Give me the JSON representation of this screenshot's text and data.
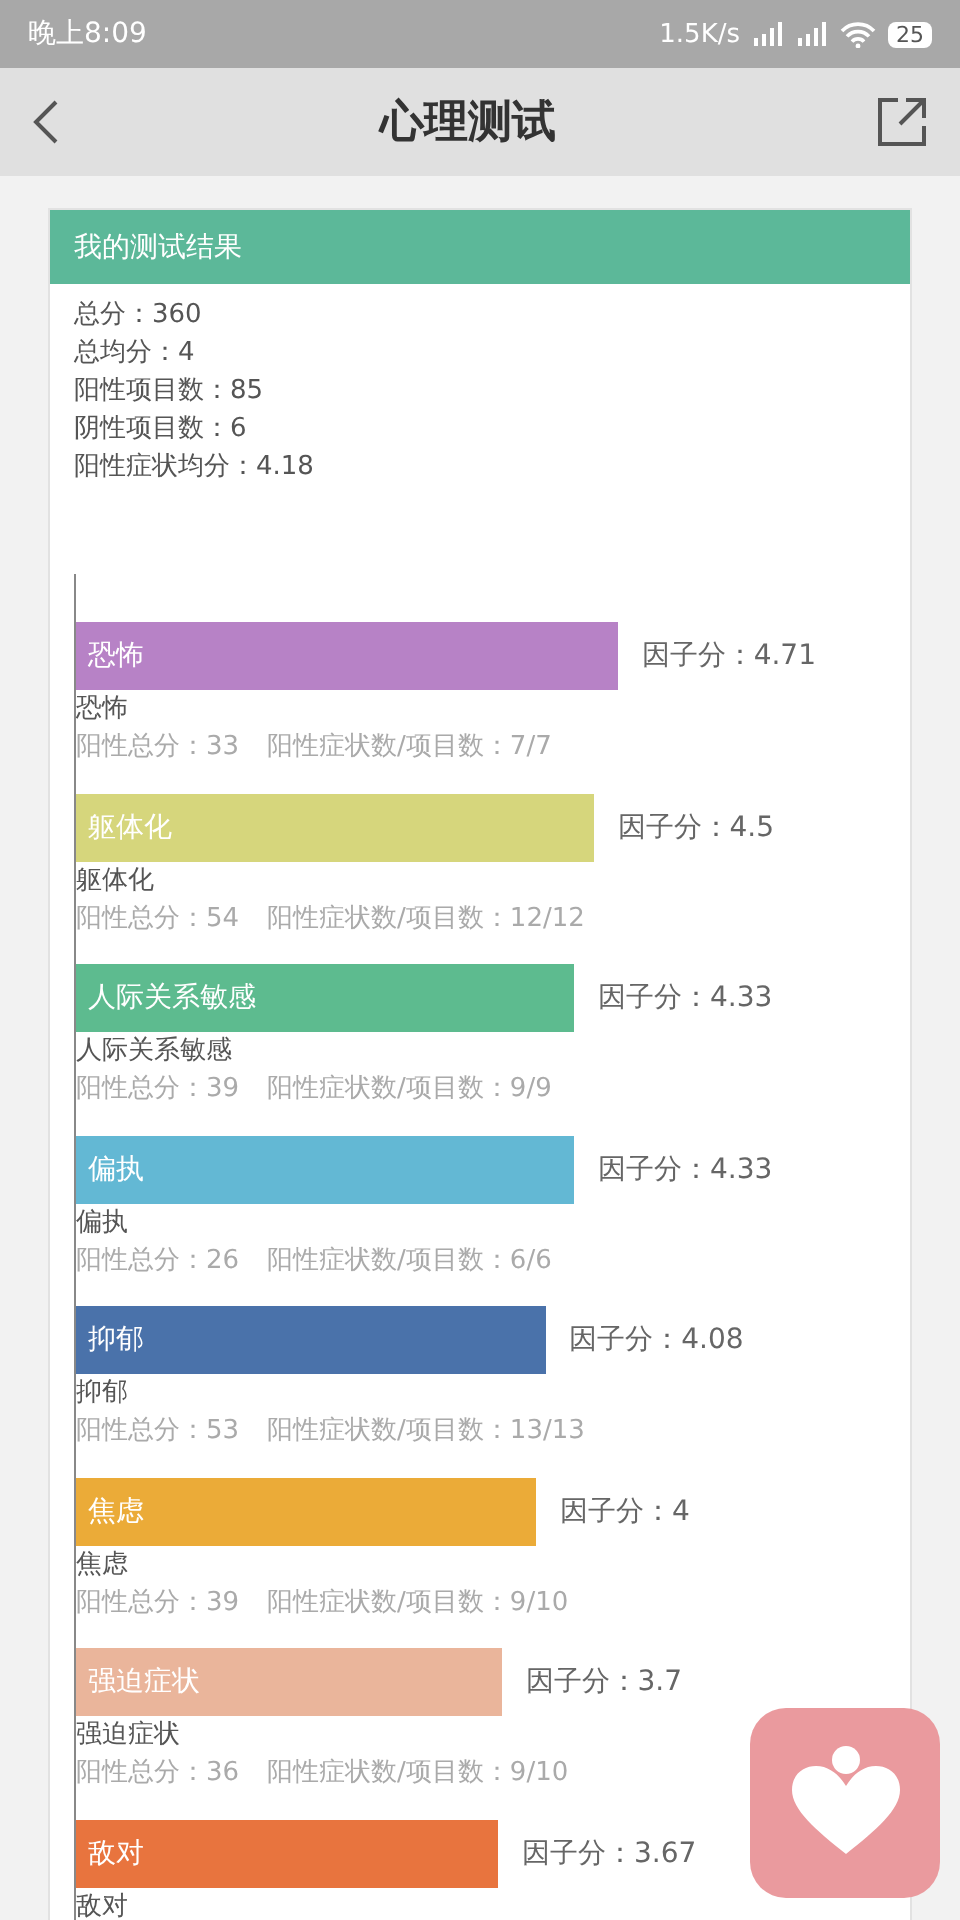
{
  "status_bar": {
    "time": "晚上8:09",
    "speed": "1.5K/s",
    "battery": "25"
  },
  "nav": {
    "title": "心理测试"
  },
  "card": {
    "title": "我的测试结果",
    "summary": [
      "总分：360",
      "总均分：4",
      "阳性项目数：85",
      "阴性项目数：6",
      "阳性症状均分：4.18"
    ],
    "factors": [
      {
        "bar_label": "恐怖",
        "color": "#b782c6",
        "score": "因子分：4.71",
        "name": "恐怖",
        "stat_total": "阳性总分：33",
        "stat_ratio": "阳性症状数/项目数：7/7"
      },
      {
        "bar_label": "躯体化",
        "color": "#d6d67c",
        "score": "因子分：4.5",
        "name": "躯体化",
        "stat_total": "阳性总分：54",
        "stat_ratio": "阳性症状数/项目数：12/12"
      },
      {
        "bar_label": "人际关系敏感",
        "color": "#5dbb8f",
        "score": "因子分：4.33",
        "name": "人际关系敏感",
        "stat_total": "阳性总分：39",
        "stat_ratio": "阳性症状数/项目数：9/9"
      },
      {
        "bar_label": "偏执",
        "color": "#63b8d4",
        "score": "因子分：4.33",
        "name": "偏执",
        "stat_total": "阳性总分：26",
        "stat_ratio": "阳性症状数/项目数：6/6"
      },
      {
        "bar_label": "抑郁",
        "color": "#4a72aa",
        "score": "因子分：4.08",
        "name": "抑郁",
        "stat_total": "阳性总分：53",
        "stat_ratio": "阳性症状数/项目数：13/13"
      },
      {
        "bar_label": "焦虑",
        "color": "#ebab38",
        "score": "因子分：4",
        "name": "焦虑",
        "stat_total": "阳性总分：39",
        "stat_ratio": "阳性症状数/项目数：9/10"
      },
      {
        "bar_label": "强迫症状",
        "color": "#eab59b",
        "score": "因子分：3.7",
        "name": "强迫症状",
        "stat_total": "阳性总分：36",
        "stat_ratio": "阳性症状数/项目数：9/10"
      },
      {
        "bar_label": "敌对",
        "color": "#e8743e",
        "score": "因子分：3.67",
        "name": "敌对"
      }
    ]
  }
}
